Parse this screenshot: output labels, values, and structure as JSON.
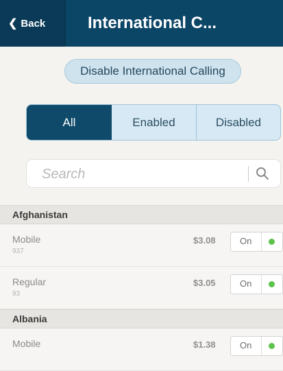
{
  "nav": {
    "back_label": "Back",
    "title": "International C..."
  },
  "disable_button": "Disable International Calling",
  "segments": [
    "All",
    "Enabled",
    "Disabled"
  ],
  "search": {
    "placeholder": "Search",
    "icon": "search-icon"
  },
  "sections": [
    {
      "name": "Afghanistan",
      "rows": [
        {
          "label": "Mobile",
          "code": "937",
          "price": "$3.08",
          "toggle": "On"
        },
        {
          "label": "Regular",
          "code": "93",
          "price": "$3.05",
          "toggle": "On"
        }
      ]
    },
    {
      "name": "Albania",
      "rows": [
        {
          "label": "Mobile",
          "code": "",
          "price": "$1.38",
          "toggle": "On"
        }
      ]
    }
  ],
  "colors": {
    "nav": "#0c4667",
    "segment_active": "#0f4a6b",
    "toggle_dot": "#5cc34a"
  }
}
